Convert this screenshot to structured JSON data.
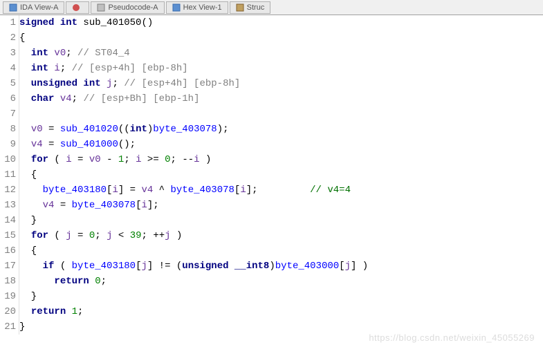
{
  "tabs": [
    {
      "label": "IDA View-A"
    },
    {
      "label": ""
    },
    {
      "label": "Pseudocode-A"
    },
    {
      "label": "Hex View-1"
    },
    {
      "label": "Struc"
    }
  ],
  "gutter": [
    "1",
    "2",
    "3",
    "4",
    "5",
    "6",
    "7",
    "8",
    "9",
    "10",
    "11",
    "12",
    "13",
    "14",
    "15",
    "16",
    "17",
    "18",
    "19",
    "20",
    "21"
  ],
  "code": {
    "l1_signed": "signed",
    "l1_int": " int",
    "l1_fn": " sub_401050",
    "l1_paren": "()",
    "l2": "{",
    "l3_type": "  int",
    "l3_var": " v0",
    "l3_semi": ";",
    "l3_comment": " // ST04_4",
    "l4_type": "  int",
    "l4_var": " i",
    "l4_semi": ";",
    "l4_comment": " // [esp+4h] [ebp-8h]",
    "l5_type": "  unsigned int",
    "l5_var": " j",
    "l5_semi": ";",
    "l5_comment": " // [esp+4h] [ebp-8h]",
    "l6_type": "  char",
    "l6_var": " v4",
    "l6_semi": ";",
    "l6_comment": " // [esp+Bh] [ebp-1h]",
    "l7": "",
    "l8_pre": "  ",
    "l8_v0": "v0",
    "l8_eq": " = ",
    "l8_fn": "sub_401020",
    "l8_p1": "((",
    "l8_int": "int",
    "l8_p2": ")",
    "l8_byte": "byte_403078",
    "l8_end": ");",
    "l9_pre": "  ",
    "l9_v4": "v4",
    "l9_eq": " = ",
    "l9_fn": "sub_401000",
    "l9_end": "();",
    "l10_pre": "  ",
    "l10_for": "for",
    "l10_p1": " ( ",
    "l10_i": "i",
    "l10_eq": " = ",
    "l10_v0": "v0",
    "l10_m1": " - ",
    "l10_one": "1",
    "l10_sc1": "; ",
    "l10_i2": "i",
    "l10_ge": " >= ",
    "l10_zero": "0",
    "l10_sc2": "; --",
    "l10_i3": "i",
    "l10_p2": " )",
    "l11": "  {",
    "l12_pre": "    ",
    "l12_arr": "byte_403180",
    "l12_b1": "[",
    "l12_i": "i",
    "l12_b2": "] = ",
    "l12_v4": "v4",
    "l12_xor": " ^ ",
    "l12_arr2": "byte_403078",
    "l12_b3": "[",
    "l12_i2": "i",
    "l12_b4": "];",
    "l12_spaces": "         ",
    "l12_comment": "// v4=4",
    "l13_pre": "    ",
    "l13_v4": "v4",
    "l13_eq": " = ",
    "l13_arr": "byte_403078",
    "l13_b1": "[",
    "l13_i": "i",
    "l13_b2": "];",
    "l14": "  }",
    "l15_pre": "  ",
    "l15_for": "for",
    "l15_p1": " ( ",
    "l15_j": "j",
    "l15_eq": " = ",
    "l15_zero": "0",
    "l15_sc1": "; ",
    "l15_j2": "j",
    "l15_lt": " < ",
    "l15_39": "39",
    "l15_sc2": "; ++",
    "l15_j3": "j",
    "l15_p2": " )",
    "l16": "  {",
    "l17_pre": "    ",
    "l17_if": "if",
    "l17_p1": " ( ",
    "l17_arr": "byte_403180",
    "l17_b1": "[",
    "l17_j": "j",
    "l17_b2": "] != (",
    "l17_cast": "unsigned __int8",
    "l17_p2": ")",
    "l17_arr2": "byte_403000",
    "l17_b3": "[",
    "l17_j2": "j",
    "l17_b4": "] )",
    "l18_pre": "      ",
    "l18_ret": "return",
    "l18_sp": " ",
    "l18_zero": "0",
    "l18_sc": ";",
    "l19": "  }",
    "l20_pre": "  ",
    "l20_ret": "return",
    "l20_sp": " ",
    "l20_one": "1",
    "l20_sc": ";",
    "l21": "}"
  },
  "watermark": "https://blog.csdn.net/weixin_45055269"
}
